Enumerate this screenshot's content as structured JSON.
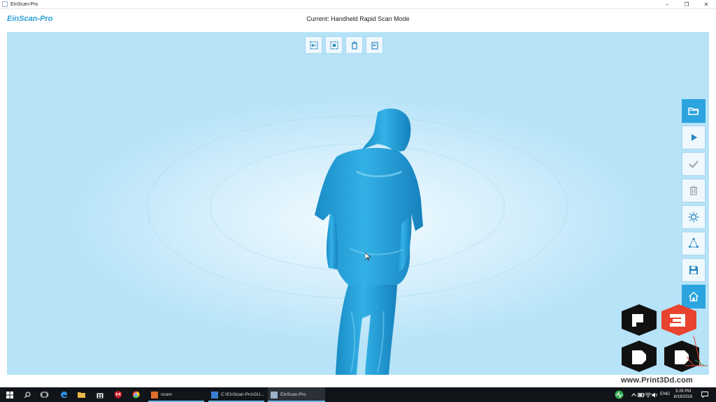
{
  "window": {
    "title": "EinScan-Pro",
    "buttons": [
      "minimize",
      "restore",
      "close"
    ]
  },
  "header": {
    "brand": "EinScan-Pro",
    "mode_text": "Current: Handheld  Rapid Scan Mode"
  },
  "top_toolbar": {
    "items": [
      {
        "icon": "exit-frame-icon"
      },
      {
        "icon": "select-region-icon"
      },
      {
        "icon": "delete-icon"
      },
      {
        "icon": "undo-icon"
      }
    ]
  },
  "side_toolbar": {
    "items": [
      {
        "icon": "open-folder-icon",
        "active": true
      },
      {
        "icon": "play-icon",
        "active": false
      },
      {
        "icon": "check-icon",
        "active": false
      },
      {
        "icon": "trash-icon",
        "active": false
      },
      {
        "icon": "brightness-icon",
        "active": false
      },
      {
        "icon": "align-icon",
        "active": false
      },
      {
        "icon": "save-icon",
        "active": false
      },
      {
        "icon": "home-icon",
        "active": true
      }
    ]
  },
  "watermark": {
    "url": "www.Print3Dd.com"
  },
  "taskbar": {
    "tasks": [
      {
        "label": "ocam"
      },
      {
        "label": "C:\\EinScan-Pro\\GU..."
      },
      {
        "label": "EinScan-Pro"
      }
    ],
    "language": "ENG",
    "time": "3:28 PM",
    "date": "8/19/2016"
  },
  "colors": {
    "accent": "#2ba4e0",
    "model": "#1f93cc",
    "viewport_bg": "#c8eafa",
    "taskbar": "#111418"
  }
}
